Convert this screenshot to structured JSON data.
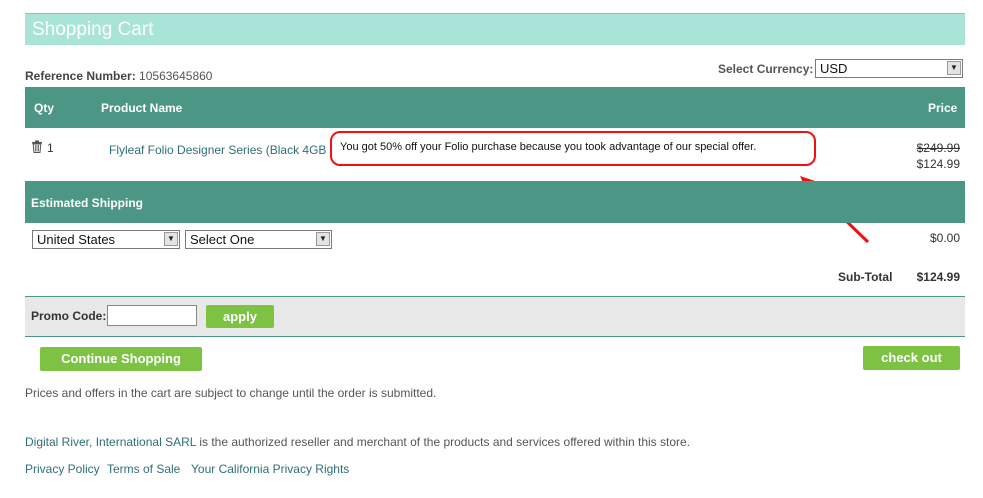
{
  "header": {
    "title": "Shopping Cart"
  },
  "reference": {
    "label": "Reference Number:",
    "value": "10563645860"
  },
  "currency": {
    "label": "Select Currency:",
    "selected": "USD"
  },
  "table": {
    "headers": {
      "qty": "Qty",
      "product": "Product Name",
      "price": "Price"
    },
    "items": [
      {
        "qty": "1",
        "name": "Flyleaf Folio Designer Series (Black 4GB",
        "original_price": "$249.99",
        "price": "$124.99"
      }
    ]
  },
  "callout": {
    "text": "You got 50% off your Folio purchase because you took advantage of our special offer."
  },
  "shipping": {
    "header": "Estimated Shipping",
    "country": "United States",
    "method": "Select One",
    "cost": "$0.00",
    "subtotal_label": "Sub-Total",
    "subtotal_value": "$124.99"
  },
  "promo": {
    "label": "Promo Code:",
    "value": "",
    "apply_label": "apply"
  },
  "buttons": {
    "continue": "Continue Shopping",
    "checkout": "check out"
  },
  "notice": "Prices and offers in the cart are subject to change until the order is submitted.",
  "reseller": {
    "link": "Digital River, International SARL",
    "text": " is the authorized reseller and merchant of the products and services offered within this store."
  },
  "footer_links": [
    "Privacy Policy",
    "Terms of Sale",
    "Your California Privacy Rights"
  ],
  "colors": {
    "header": "#a8e4d8",
    "teal": "#4c9686",
    "green": "#7dc242",
    "link": "#2e6f77",
    "callout": "#e11111"
  },
  "icons": {
    "delete": "trash-icon",
    "annotation": "arrow-icon"
  }
}
